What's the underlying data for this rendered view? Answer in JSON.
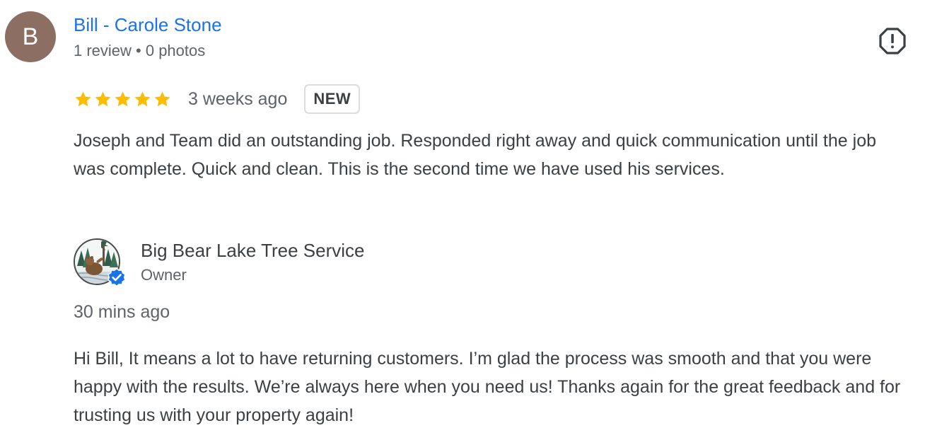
{
  "reviewer": {
    "avatar_letter": "B",
    "avatar_color": "#8d6e63",
    "name": "Bill - Carole Stone",
    "meta": "1 review • 0 photos"
  },
  "flag": {
    "icon": "report-flag-icon"
  },
  "review": {
    "rating": 5,
    "rating_max": 5,
    "star_color": "#fbbc04",
    "time": "3 weeks ago",
    "badge": "NEW",
    "text": "Joseph and Team did an outstanding job. Responded right away and quick communication until the job was complete. Quick and clean. This is the second time we have used his services."
  },
  "owner_response": {
    "name": "Big Bear Lake Tree Service",
    "role": "Owner",
    "verified_icon": "verified-check-icon",
    "verified_color": "#1a73e8",
    "time": "30 mins ago",
    "text": "Hi Bill, It means a lot to have returning customers. I’m glad the process was smooth and that you were happy with the results. We’re always here when you need us! Thanks again for the great feedback and for trusting us with your property again!"
  },
  "colors": {
    "link": "#1a73e8",
    "text": "#3c4043",
    "secondary": "#5f6368"
  }
}
